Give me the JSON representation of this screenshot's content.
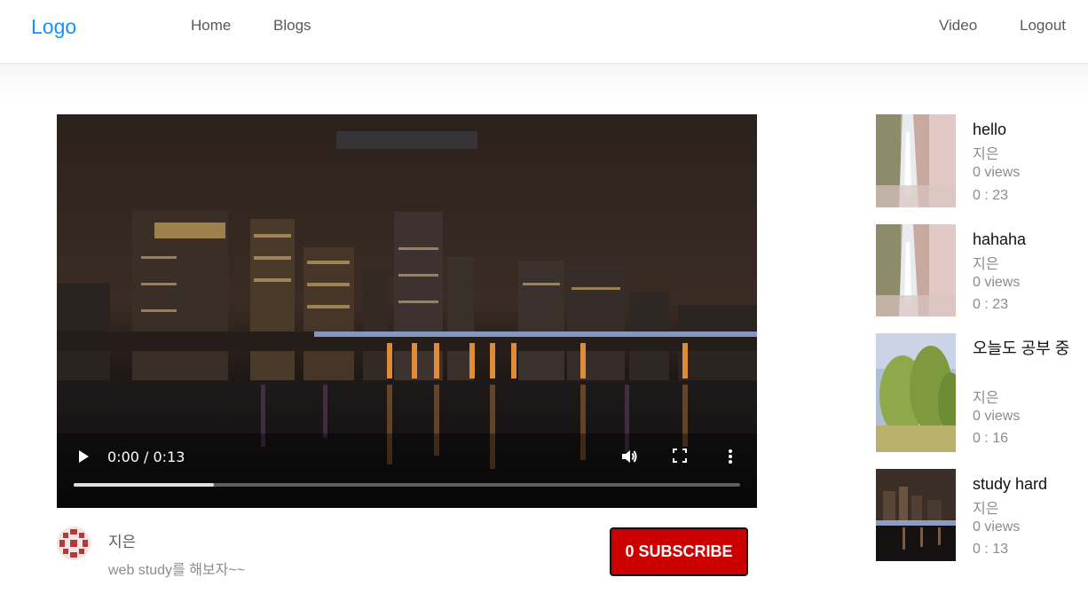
{
  "nav": {
    "logo": "Logo",
    "left_links": [
      "Home",
      "Blogs"
    ],
    "right_links": [
      "Video",
      "Logout"
    ]
  },
  "player": {
    "time": "0:00 / 0:13",
    "progress_fraction": 0.21,
    "icons": [
      "play-icon",
      "volume-icon",
      "fullscreen-icon",
      "more-icon"
    ]
  },
  "author": {
    "name": "지은",
    "description": "web study를 해보자~~"
  },
  "subscribe": {
    "label": "0 SUBSCRIBE",
    "color": "#cc0000"
  },
  "sidebar": {
    "items": [
      {
        "title": "hello",
        "writer": "지은",
        "views": "0 views",
        "duration": "0 : 23"
      },
      {
        "title": "hahaha",
        "writer": "지은",
        "views": "0 views",
        "duration": "0 : 23"
      },
      {
        "title": "오늘도 공부 중",
        "writer": "지은",
        "views": "0 views",
        "duration": "0 : 16"
      },
      {
        "title": "study hard",
        "writer": "지은",
        "views": "0 views",
        "duration": "0 : 13"
      }
    ]
  },
  "colors": {
    "logo": "#1890ff",
    "nav_text": "#595959",
    "meta_text": "#8c8c8c"
  }
}
